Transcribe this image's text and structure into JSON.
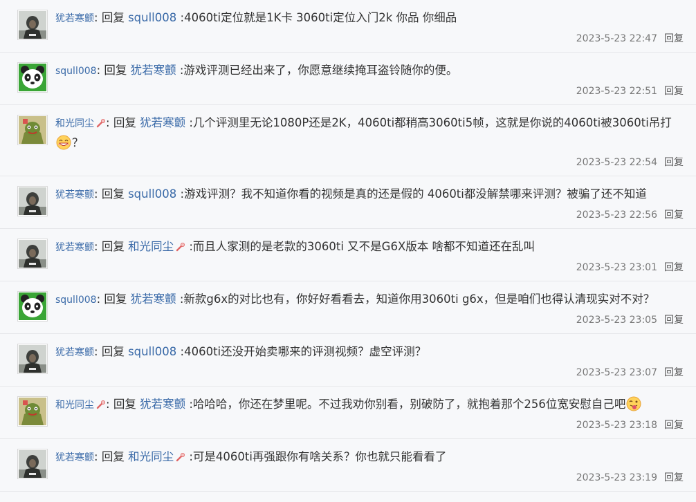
{
  "reply_label": "回复",
  "replies": [
    {
      "user": "犹若寒颤",
      "medal": false,
      "target": "squll008",
      "target_medal": false,
      "text": ":4060ti定位就是1K卡 3060ti定位入门2k 你品 你细品",
      "emoji": "",
      "emoji_icon": "",
      "time": "2023-5-23 22:47",
      "avatar": "soldier-avatar"
    },
    {
      "user": "squll008",
      "medal": false,
      "target": "犹若寒颤",
      "target_medal": false,
      "text": ":游戏评测已经出来了，你愿意继续掩耳盗铃随你的便。",
      "emoji": "",
      "emoji_icon": "",
      "time": "2023-5-23 22:51",
      "avatar": "panda-avatar"
    },
    {
      "user": "和光同尘",
      "medal": true,
      "target": "犹若寒颤",
      "target_medal": false,
      "text": ":几个评测里无论1080P还是2K，4060ti都稍高3060ti5帧，这就是你说的4060ti被3060ti吊打",
      "emoji": "？",
      "emoji_icon": "laugh-emoji-icon",
      "time": "2023-5-23 22:54",
      "avatar": "cartoon-avatar"
    },
    {
      "user": "犹若寒颤",
      "medal": false,
      "target": "squll008",
      "target_medal": false,
      "text": ":游戏评测？我不知道你看的视频是真的还是假的 4060ti都没解禁哪来评测？被骗了还不知道",
      "emoji": "",
      "emoji_icon": "",
      "time": "2023-5-23 22:56",
      "avatar": "soldier-avatar"
    },
    {
      "user": "犹若寒颤",
      "medal": false,
      "target": "和光同尘",
      "target_medal": true,
      "text": ":而且人家测的是老款的3060ti 又不是G6X版本 啥都不知道还在乱叫",
      "emoji": "",
      "emoji_icon": "",
      "time": "2023-5-23 23:01",
      "avatar": "soldier-avatar"
    },
    {
      "user": "squll008",
      "medal": false,
      "target": "犹若寒颤",
      "target_medal": false,
      "text": ":新款g6x的对比也有，你好好看看去，知道你用3060ti g6x，但是咱们也得认清现实对不对？",
      "emoji": "",
      "emoji_icon": "",
      "time": "2023-5-23 23:05",
      "avatar": "panda-avatar"
    },
    {
      "user": "犹若寒颤",
      "medal": false,
      "target": "squll008",
      "target_medal": false,
      "text": ":4060ti还没开始卖哪来的评测视频？虚空评测？",
      "emoji": "",
      "emoji_icon": "",
      "time": "2023-5-23 23:07",
      "avatar": "soldier-avatar"
    },
    {
      "user": "和光同尘",
      "medal": true,
      "target": "犹若寒颤",
      "target_medal": false,
      "text": ":哈哈哈，你还在梦里呢。不过我劝你别看，别破防了，就抱着那个256位宽安慰自己吧",
      "emoji": "",
      "emoji_icon": "tongue-emoji-icon",
      "time": "2023-5-23 23:18",
      "avatar": "cartoon-avatar"
    },
    {
      "user": "犹若寒颤",
      "medal": false,
      "target": "和光同尘",
      "target_medal": true,
      "text": ":可是4060ti再强跟你有啥关系？你也就只能看看了",
      "emoji": "",
      "emoji_icon": "",
      "time": "2023-5-23 23:19",
      "avatar": "soldier-avatar"
    }
  ]
}
